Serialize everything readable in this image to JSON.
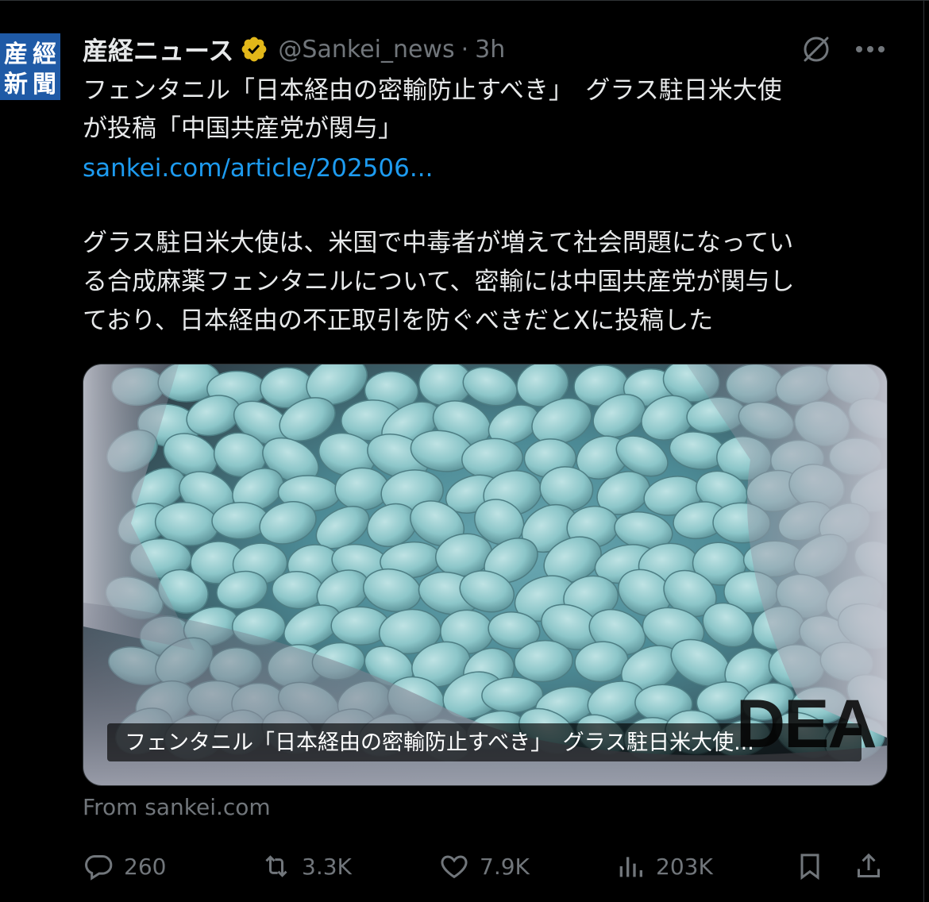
{
  "account": {
    "avatar_glyphs": [
      "産",
      "經",
      "新",
      "聞"
    ],
    "name": "産経ニュース",
    "handle": "@Sankei_news",
    "separator": "·",
    "time": "3h"
  },
  "post": {
    "line1": "フェンタニル「日本経由の密輸防止すべき」　グラス駐日米大使",
    "line2": "が投稿「中国共産党が関与」",
    "link": "sankei.com/article/202506...",
    "body_lines": [
      "グラス駐日米大使は、米国で中毒者が増えて社会問題になってい",
      "る合成麻薬フェンタニルについて、密輸には中国共産党が関与し",
      "ており、日本経由の不正取引を防ぐべきだとXに投稿した"
    ]
  },
  "card": {
    "caption": "フェンタニル「日本経由の密輸防止すべき」　グラス駐日米大使...",
    "watermark": "DEA",
    "source": "From sankei.com"
  },
  "actions": {
    "replies": "260",
    "reposts": "3.3K",
    "likes": "7.9K",
    "views": "203K"
  },
  "icons": {
    "verified": "gold-verified-badge-icon",
    "grok": "grok-icon",
    "more": "more-icon",
    "reply": "reply-icon",
    "repost": "repost-icon",
    "like": "heart-icon",
    "views": "views-icon",
    "bookmark": "bookmark-icon",
    "share": "share-icon"
  },
  "colors": {
    "background": "#000000",
    "text": "#e7e9ea",
    "muted": "#71767b",
    "link": "#1d9bf0",
    "verified_gold": "#e2b719",
    "avatar_blue": "#1f5aa6"
  }
}
